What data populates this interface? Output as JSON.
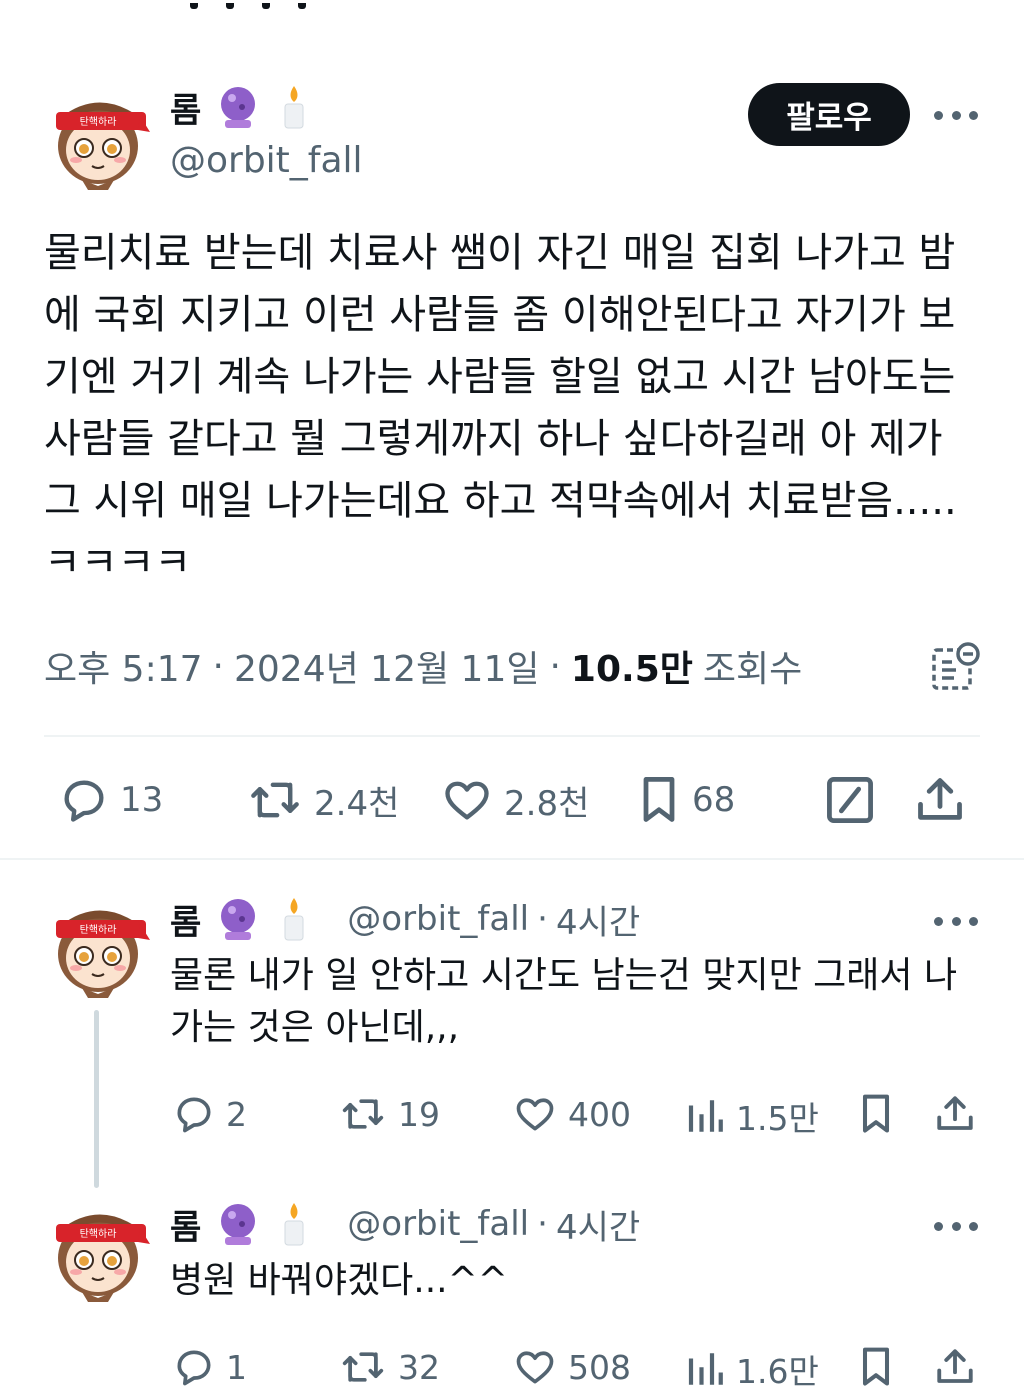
{
  "main_tweet": {
    "author_name": "롬",
    "badges": [
      "crystal-ball-icon",
      "candle-icon"
    ],
    "handle": "@orbit_fall",
    "follow_label": "팔로우",
    "text_lines": [
      "물리치료 받는데 치료사 쌤이 자긴 매일 집회 나가고 밤",
      "에 국회 지키고 이런 사람들 좀 이해안된다고 자기가 보",
      "기엔 거기 계속 나가는 사람들 할일 없고 시간 남아도는",
      "사람들 같다고 뭘 그렇게까지 하나 싶다하길래 아 제가",
      "그 시위 매일 나가는데요 하고 적막속에서 치료받음.....",
      "ㅋㅋㅋㅋ"
    ],
    "time": "오후 5:17",
    "date": "2024년 12월 11일",
    "views_count": "10.5만",
    "views_label": "조회수",
    "actions": {
      "replies": "13",
      "retweets": "2.4천",
      "likes": "2.8천",
      "bookmarks": "68"
    }
  },
  "replies": [
    {
      "author_name": "롬",
      "handle": "@orbit_fall",
      "time_ago": "4시간",
      "text_lines": [
        "물론 내가 일 안하고 시간도 남는건 맞지만 그래서 나",
        "가는 것은 아닌데,,,"
      ],
      "actions": {
        "replies": "2",
        "retweets": "19",
        "likes": "400",
        "views": "1.5만"
      }
    },
    {
      "author_name": "롬",
      "handle": "@orbit_fall",
      "time_ago": "4시간",
      "text_lines": [
        "병원 바꿔야겠다...^^"
      ],
      "actions": {
        "replies": "1",
        "retweets": "32",
        "likes": "508",
        "views": "1.6만"
      }
    }
  ],
  "avatar_headband_text": "탄핵하라",
  "colors": {
    "text_primary": "#0f1419",
    "text_secondary": "#536471",
    "divider": "#eff3f4",
    "headband": "#d8232a"
  }
}
